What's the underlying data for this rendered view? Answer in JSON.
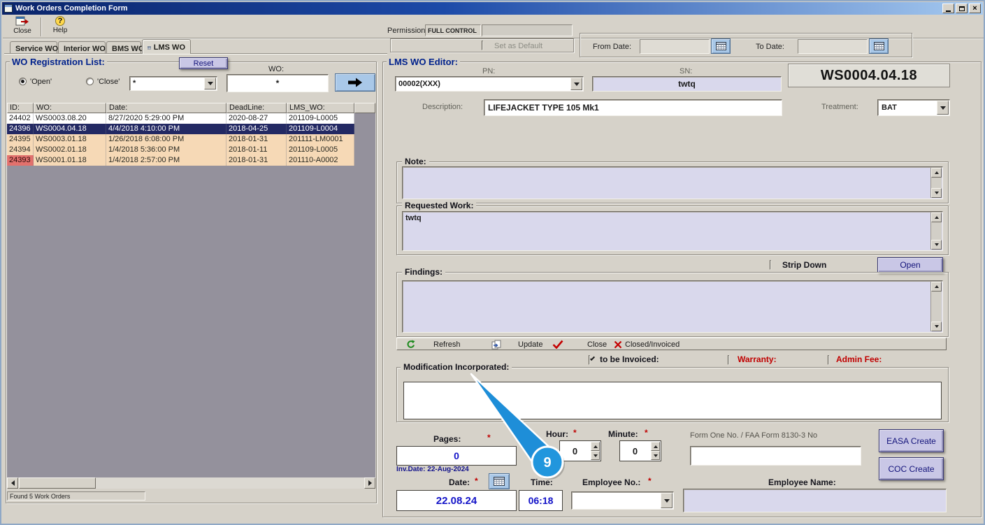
{
  "window": {
    "title": "Work Orders Completion Form",
    "close_glyph": "×"
  },
  "toolbar": {
    "close_label": "Close",
    "help_label": "Help",
    "permission_label": "Permission:",
    "permission_value": "FULL CONTROL"
  },
  "tabs": [
    {
      "label": "Service WO"
    },
    {
      "label": "Interior WO"
    },
    {
      "label": "BMS WO"
    },
    {
      "label": "LMS WO"
    }
  ],
  "options": {
    "set_as_default": "Set as Default"
  },
  "date_range": {
    "from_label": "From Date:",
    "from_value": "",
    "to_label": "To Date:",
    "to_value": ""
  },
  "registration_list": {
    "title": "WO Registration List:",
    "reset_label": "Reset",
    "open_radio": "'Open'",
    "close_radio": "'Close'",
    "filter_value": "*",
    "wo_label": "WO:",
    "wo_value": "*",
    "columns": [
      "ID:",
      "WO:",
      "Date:",
      "DeadLine:",
      "LMS_WO:"
    ],
    "rows": [
      {
        "id": "24402",
        "wo": "WS0003.08.20",
        "date": "8/27/2020 5:29:00 PM",
        "deadline": "2020-08-27",
        "lms_wo": "201109-L0005",
        "highlight": "white"
      },
      {
        "id": "24396",
        "wo": "WS0004.04.18",
        "date": "4/4/2018 4:10:00 PM",
        "deadline": "2018-04-25",
        "lms_wo": "201109-L0004",
        "highlight": "selected"
      },
      {
        "id": "24395",
        "wo": "WS0003.01.18",
        "date": "1/26/2018 6:08:00 PM",
        "deadline": "2018-01-31",
        "lms_wo": "201111-LM0001",
        "highlight": "peach"
      },
      {
        "id": "24394",
        "wo": "WS0002.01.18",
        "date": "1/4/2018 5:36:00 PM",
        "deadline": "2018-01-11",
        "lms_wo": "201109-L0005",
        "highlight": "peach"
      },
      {
        "id": "24393",
        "wo": "WS0001.01.18",
        "date": "1/4/2018 2:57:00 PM",
        "deadline": "2018-01-31",
        "lms_wo": "201110-A0002",
        "highlight": "peach-red-id"
      }
    ],
    "status": "Found 5 Work Orders"
  },
  "editor": {
    "title": "LMS WO Editor:",
    "pn_label": "PN:",
    "pn_value": "00002(XXX)",
    "sn_label": "SN:",
    "sn_value": "twtq",
    "wo_number": "WS0004.04.18",
    "description_label": "Description:",
    "description_value": "LIFEJACKET TYPE 105 Mk1",
    "treatment_label": "Treatment:",
    "treatment_value": "BAT",
    "note_label": "Note:",
    "note_value": "",
    "requested_work_label": "Requested Work:",
    "requested_work_value": "twtq",
    "strip_down_label": "Strip Down",
    "open_button_label": "Open",
    "findings_label": "Findings:",
    "findings_value": "",
    "actions": {
      "refresh": "Refresh",
      "update": "Update",
      "close": "Close",
      "closed_invoiced": "Closed/Invoiced"
    },
    "flags": {
      "to_be_invoiced": "to be Invoiced:",
      "warranty": "Warranty:",
      "admin_fee": "Admin Fee:"
    },
    "modification_label": "Modification Incorporated:",
    "modification_value": "",
    "pages_label": "Pages:",
    "pages_value": "0",
    "hour_label": "Hour:",
    "hour_value": "0",
    "minute_label": "Minute:",
    "minute_value": "0",
    "form_one_label": "Form One No. / FAA Form 8130-3 No",
    "form_one_value": "",
    "easa_create_label": "EASA Create",
    "coc_create_label": "COC Create",
    "inv_date": "Inv.Date: 22-Aug-2024",
    "date_label": "Date:",
    "date_value": "22.08.24",
    "time_label": "Time:",
    "time_value": "06:18",
    "employee_no_label": "Employee No.:",
    "employee_no_value": "",
    "employee_name_label": "Employee Name:",
    "employee_name_value": ""
  },
  "required_marker": "*",
  "annotation": {
    "step_number": "9"
  },
  "icons": {
    "help": "?",
    "exit": "door-with-arrow",
    "calendar": "calendar-grid",
    "go_arrow": "black-right-arrow",
    "refresh": "green-circular-arrow",
    "update": "copy-pages",
    "confirm": "red-check",
    "closed": "red-x",
    "lms_tab": "table-grid"
  },
  "colors": {
    "titlebar_start": "#0a246a",
    "titlebar_end": "#a6caf0",
    "window_bg": "#d6d2c9",
    "button_lavender": "#c9c7e6",
    "button_blue": "#a9c8e8",
    "field_lavender": "#d9d8ec",
    "row_selected": "#232963",
    "row_peach": "#f6d9b6",
    "cell_red": "#e2716d",
    "label_navy": "#00218c",
    "label_red": "#cc0000",
    "value_blue": "#1313c8",
    "grid_empty": "#94919c",
    "annotation_blue": "#1e8ed8"
  }
}
